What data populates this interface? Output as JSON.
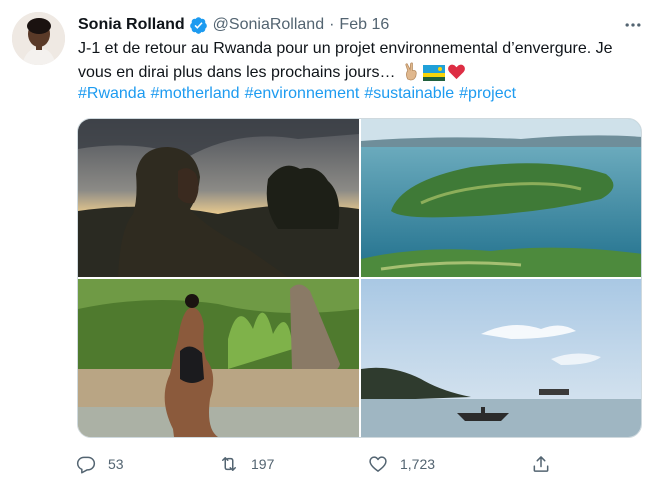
{
  "tweet": {
    "author_name": "Sonia Rolland",
    "handle": "@SoniaRolland",
    "separator": "·",
    "date": "Feb 16",
    "text": "J-1 et de retour au Rwanda pour un projet environnemental d’envergure. Je vous en dirai plus dans les prochains jours… ",
    "hashtags": [
      "#Rwanda",
      "#motherland",
      "#environnement",
      "#sustainable",
      "#project"
    ],
    "emojis": [
      "victory-hand-emoji",
      "rwanda-flag-emoji",
      "red-heart-emoji"
    ],
    "media": [
      {
        "icon": "photo-woman-hood-sunset"
      },
      {
        "icon": "photo-island-aerial-lake"
      },
      {
        "icon": "photo-woman-swimsuit-sand"
      },
      {
        "icon": "photo-lake-canoe-hills"
      }
    ]
  },
  "actions": {
    "reply_count": "53",
    "retweet_count": "197",
    "like_count": "1,723"
  },
  "colors": {
    "link": "#1d9bf0",
    "verified": "#1d9bf0",
    "secondary_text": "#536471",
    "border": "#cfd9de"
  }
}
